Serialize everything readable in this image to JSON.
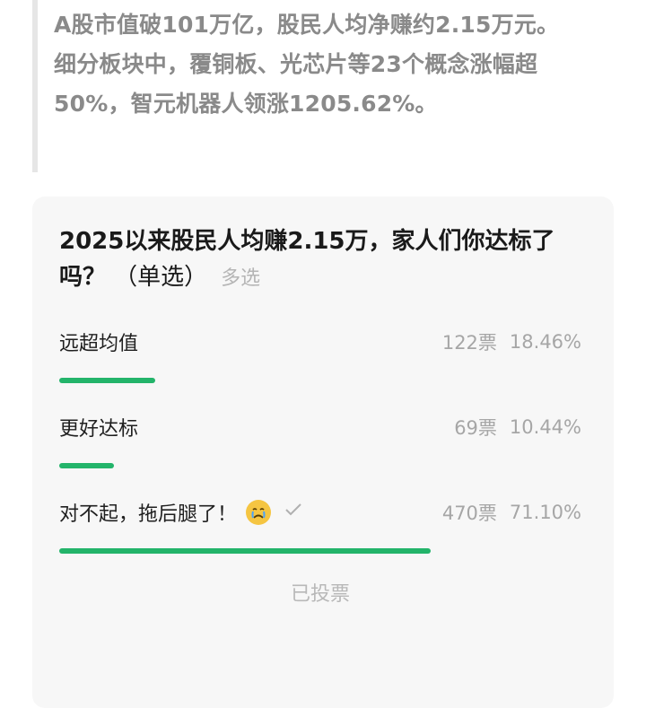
{
  "quote": {
    "lines": [
      "A股市值破101万亿，股民人均净赚约2.15万元。",
      "细分板块中，覆铜板、光芯片等23个概念涨幅超",
      "50%，智元机器人领涨1205.62%。"
    ]
  },
  "poll": {
    "title": "2025以来股民人均赚2.15万，家人们你达标了吗？",
    "type_label": "（单选）",
    "alt_type_label": "多选",
    "options": [
      {
        "label": "远超均值",
        "votes": "122票",
        "percent": "18.46%",
        "fraction": 0.1846,
        "selected": false
      },
      {
        "label": "更好达标",
        "votes": "69票",
        "percent": "10.44%",
        "fraction": 0.1044,
        "selected": false
      },
      {
        "label": "对不起，拖后腿了！",
        "emoji": "crying-face-icon",
        "votes": "470票",
        "percent": "71.10%",
        "fraction": 0.711,
        "selected": true
      }
    ],
    "status": "已投票",
    "accent_color": "#23b46a"
  }
}
